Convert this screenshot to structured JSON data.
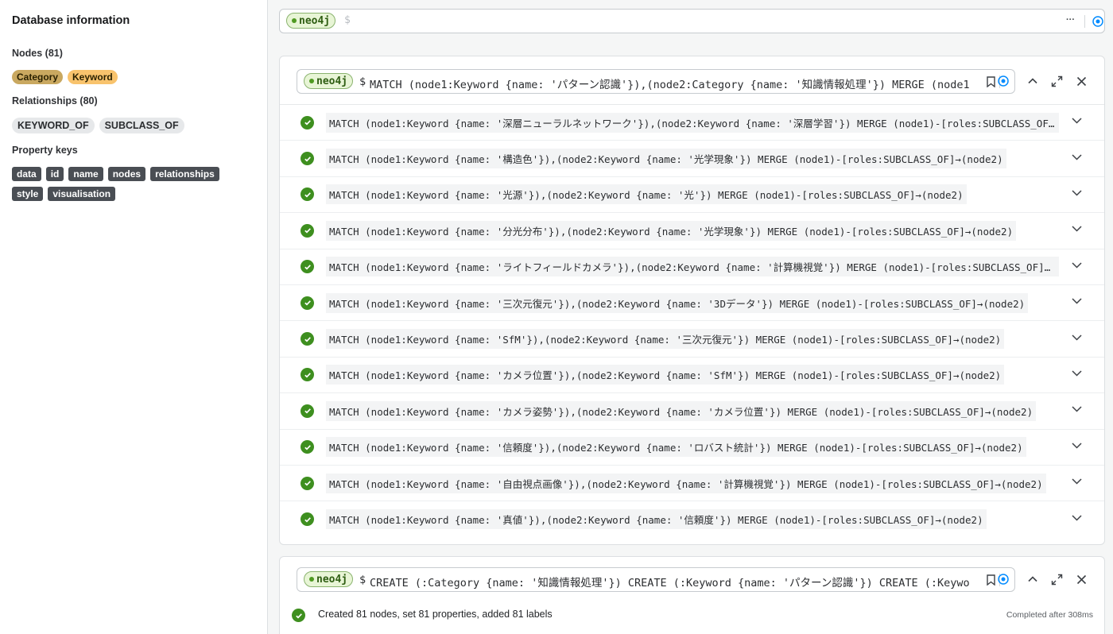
{
  "sidebar": {
    "title": "Database information",
    "nodes_heading": "Nodes (81)",
    "node_labels": [
      {
        "label": "Category",
        "color": "#c9a860"
      },
      {
        "label": "Keyword",
        "color": "#f8c36d"
      }
    ],
    "relationships_heading": "Relationships (80)",
    "relationship_types": [
      "KEYWORD_OF",
      "SUBCLASS_OF"
    ],
    "property_keys_heading": "Property keys",
    "property_keys": [
      "data",
      "id",
      "name",
      "nodes",
      "relationships",
      "style",
      "visualisation"
    ]
  },
  "editor": {
    "db_badge": "neo4j",
    "prompt": "$",
    "more_label": "···"
  },
  "frame1": {
    "db_badge": "neo4j",
    "prompt": "$",
    "query": "MATCH (node1:Keyword {name: 'パターン認識'}),(node2:Category {name: '知識情報処理'}) MERGE (node1",
    "rows": [
      "MATCH (node1:Keyword {name: '深層ニューラルネットワーク'}),(node2:Keyword {name: '深層学習'}) MERGE (node1)-[roles:SUBCLASS_OF]→(no…",
      "MATCH (node1:Keyword {name: '構造色'}),(node2:Keyword {name: '光学現象'}) MERGE (node1)-[roles:SUBCLASS_OF]→(node2)",
      "MATCH (node1:Keyword {name: '光源'}),(node2:Keyword {name: '光'}) MERGE (node1)-[roles:SUBCLASS_OF]→(node2)",
      "MATCH (node1:Keyword {name: '分光分布'}),(node2:Keyword {name: '光学現象'}) MERGE (node1)-[roles:SUBCLASS_OF]→(node2)",
      "MATCH (node1:Keyword {name: 'ライトフィールドカメラ'}),(node2:Keyword {name: '計算機視覚'}) MERGE (node1)-[roles:SUBCLASS_OF]→(nod…",
      "MATCH (node1:Keyword {name: '三次元復元'}),(node2:Keyword {name: '3Dデータ'}) MERGE (node1)-[roles:SUBCLASS_OF]→(node2)",
      "MATCH (node1:Keyword {name: 'SfM'}),(node2:Keyword {name: '三次元復元'}) MERGE (node1)-[roles:SUBCLASS_OF]→(node2)",
      "MATCH (node1:Keyword {name: 'カメラ位置'}),(node2:Keyword {name: 'SfM'}) MERGE (node1)-[roles:SUBCLASS_OF]→(node2)",
      "MATCH (node1:Keyword {name: 'カメラ姿勢'}),(node2:Keyword {name: 'カメラ位置'}) MERGE (node1)-[roles:SUBCLASS_OF]→(node2)",
      "MATCH (node1:Keyword {name: '信頼度'}),(node2:Keyword {name: 'ロバスト統計'}) MERGE (node1)-[roles:SUBCLASS_OF]→(node2)",
      "MATCH (node1:Keyword {name: '自由視点画像'}),(node2:Keyword {name: '計算機視覚'}) MERGE (node1)-[roles:SUBCLASS_OF]→(node2)",
      "MATCH (node1:Keyword {name: '真値'}),(node2:Keyword {name: '信頼度'}) MERGE (node1)-[roles:SUBCLASS_OF]→(node2)"
    ]
  },
  "frame2": {
    "db_badge": "neo4j",
    "prompt": "$",
    "query": "CREATE (:Category {name: '知識情報処理'}) CREATE (:Keyword {name: 'パターン認識'}) CREATE (:Keywo",
    "status": "Created 81 nodes, set 81 properties, added 81 labels",
    "timing": "Completed after 308ms"
  },
  "colors": {
    "success": "#3e8f1f",
    "accent": "#018bff"
  }
}
